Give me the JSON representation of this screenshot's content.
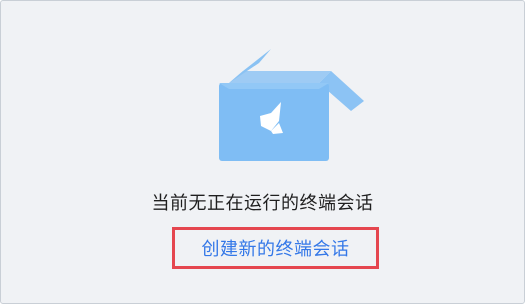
{
  "empty_state": {
    "illustration": "open-box-with-butterfly-icon",
    "message": "当前无正在运行的终端会话",
    "action_label": "创建新的终端会话"
  },
  "colors": {
    "background": "#f0f2f5",
    "box_blue": "#7fbdf4",
    "link_blue": "#3478e8",
    "highlight_red": "#e5464f"
  }
}
